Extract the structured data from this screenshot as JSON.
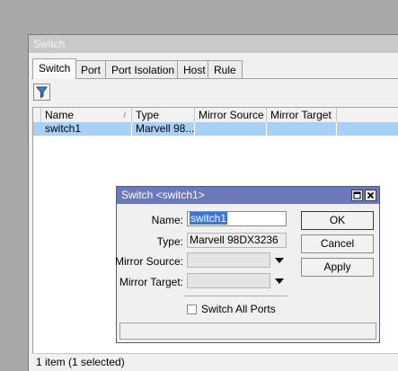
{
  "window": {
    "title": "Switch"
  },
  "tabs": [
    {
      "label": "Switch",
      "active": true
    },
    {
      "label": "Port",
      "active": false
    },
    {
      "label": "Port Isolation",
      "active": false
    },
    {
      "label": "Host",
      "active": false
    },
    {
      "label": "Rule",
      "active": false
    }
  ],
  "toolbar": {
    "filter_icon": "filter-icon"
  },
  "table": {
    "sort_indicator": "/",
    "columns": [
      "Name",
      "Type",
      "Mirror Source",
      "Mirror Target"
    ],
    "rows": [
      {
        "name": "switch1",
        "type": "Marvell 98...",
        "mirror_source": "",
        "mirror_target": ""
      }
    ]
  },
  "status": {
    "text": "1 item (1 selected)"
  },
  "dialog": {
    "title": "Switch <switch1>",
    "name_label": "Name:",
    "name_value": "switch1",
    "type_label": "Type:",
    "type_value": "Marvell 98DX3236",
    "mirror_source_label": "Mirror Source:",
    "mirror_source_value": "",
    "mirror_target_label": "Mirror Target:",
    "mirror_target_value": "",
    "switch_all_ports_label": "Switch All Ports",
    "switch_all_ports_checked": false,
    "ok_label": "OK",
    "cancel_label": "Cancel",
    "apply_label": "Apply"
  },
  "colors": {
    "dialog_title_bg": "#6b78b9",
    "selected_row": "#a9d0f5",
    "text_selection": "#3976d6"
  }
}
